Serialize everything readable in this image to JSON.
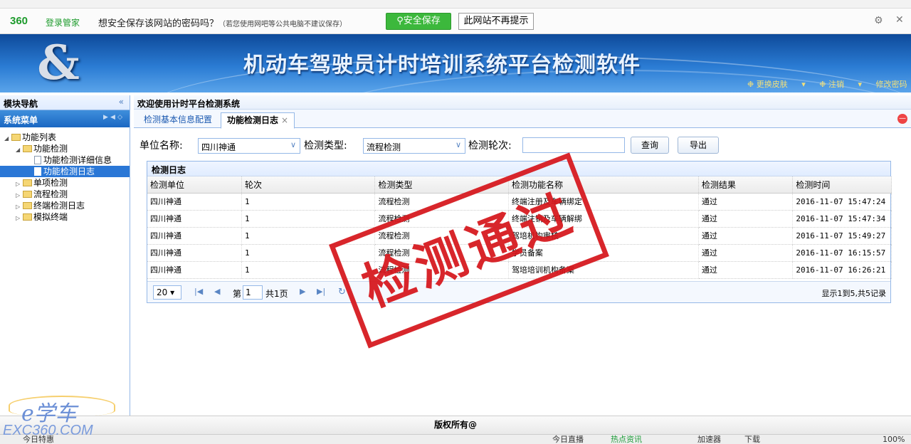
{
  "password_bar": {
    "logo": "360",
    "logo_text": "登录管家",
    "message": "想安全保存该网站的密码吗？",
    "note": "（若您使用网吧等公共电脑不建议保存）",
    "save_button": "安全保存",
    "dismiss_button": "此网站不再提示"
  },
  "banner": {
    "title": "机动车驾驶员计时培训系统平台检测软件",
    "links": [
      "更换皮肤",
      "注销",
      "修改密码"
    ]
  },
  "sidebar": {
    "header": "模块导航",
    "menu": "系统菜单",
    "tree": [
      {
        "label": "功能列表",
        "level": 0,
        "type": "folder",
        "expanded": true
      },
      {
        "label": "功能检测",
        "level": 1,
        "type": "folder",
        "expanded": true
      },
      {
        "label": "功能检测详细信息",
        "level": 2,
        "type": "file"
      },
      {
        "label": "功能检测日志",
        "level": 2,
        "type": "file",
        "selected": true
      },
      {
        "label": "单项检测",
        "level": 1,
        "type": "folder"
      },
      {
        "label": "流程检测",
        "level": 1,
        "type": "folder"
      },
      {
        "label": "终端检测日志",
        "level": 1,
        "type": "folder"
      },
      {
        "label": "模拟终端",
        "level": 1,
        "type": "folder"
      }
    ]
  },
  "content": {
    "welcome": "欢迎使用计时平台检测系统",
    "tabs": [
      {
        "label": "检测基本信息配置",
        "active": false
      },
      {
        "label": "功能检测日志",
        "active": true
      }
    ],
    "filters": {
      "unit_label": "单位名称:",
      "unit_value": "四川神通",
      "type_label": "检测类型:",
      "type_value": "流程检测",
      "round_label": "检测轮次:",
      "round_value": "",
      "query_button": "查询",
      "export_button": "导出"
    },
    "grid": {
      "title": "检测日志",
      "columns": [
        "检测单位",
        "轮次",
        "检测类型",
        "检测功能名称",
        "检测结果",
        "检测时间"
      ],
      "rows": [
        [
          "四川神通",
          "1",
          "流程检测",
          "终端注册及车辆绑定",
          "通过",
          "2016-11-07 15:47:24"
        ],
        [
          "四川神通",
          "1",
          "流程检测",
          "终端注销及车辆解绑",
          "通过",
          "2016-11-07 15:47:34"
        ],
        [
          "四川神通",
          "1",
          "流程检测",
          "驾培机构审核",
          "通过",
          "2016-11-07 15:49:27"
        ],
        [
          "四川神通",
          "1",
          "流程检测",
          "学员备案",
          "通过",
          "2016-11-07 16:15:57"
        ],
        [
          "四川神通",
          "1",
          "流程检测",
          "驾培培训机构备案",
          "通过",
          "2016-11-07 16:26:21"
        ]
      ]
    },
    "pager": {
      "page_size": "20",
      "page_label": "第",
      "page_value": "1",
      "total_pages": "共1页",
      "summary": "显示1到5,共5记录"
    }
  },
  "stamp": "检测通过",
  "footer": "版权所有@",
  "watermark": {
    "text": "e学车",
    "url": "EXC360.COM"
  },
  "statusbar": {
    "left": "今日特惠",
    "items": [
      "今日直播",
      "热点资讯",
      "加速器",
      "下载"
    ],
    "zoom": "100%"
  }
}
